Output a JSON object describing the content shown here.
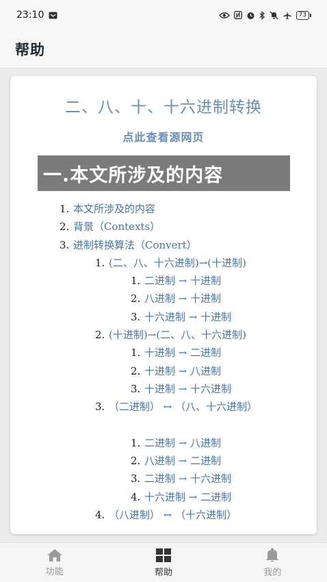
{
  "status_bar": {
    "time": "23:10",
    "battery": "73"
  },
  "app_bar": {
    "title": "帮助"
  },
  "document": {
    "title": "二、八、十、十六进制转换",
    "source_link": "点此查看源网页",
    "section_heading": "一.本文所涉及的内容",
    "toc": [
      {
        "level": 1,
        "num": "1.",
        "label": "本文所涉及的内容"
      },
      {
        "level": 1,
        "num": "2.",
        "label": "背景（Contexts）"
      },
      {
        "level": 1,
        "num": "3.",
        "label": "进制转换算法（Convert）"
      },
      {
        "level": 2,
        "num": "1.",
        "label": "(二、八、十六进制)→(十进制)"
      },
      {
        "level": 3,
        "num": "1.",
        "label": "二进制 → 十进制"
      },
      {
        "level": 3,
        "num": "2.",
        "label": "八进制 → 十进制"
      },
      {
        "level": 3,
        "num": "3.",
        "label": "十六进制 → 十进制"
      },
      {
        "level": 2,
        "num": "2.",
        "label": "(十进制)→(二、八、十六进制)"
      },
      {
        "level": 3,
        "num": "1.",
        "label": "十进制 → 二进制"
      },
      {
        "level": 3,
        "num": "2.",
        "label": "十进制 → 八进制"
      },
      {
        "level": 3,
        "num": "3.",
        "label": "十进制 → 十六进制"
      },
      {
        "level": 2,
        "num": "3.",
        "label": "（二进制） ↔ （八、十六进制）",
        "wrap": true
      },
      {
        "level": 3,
        "num": "1.",
        "label": "二进制 → 八进制"
      },
      {
        "level": 3,
        "num": "2.",
        "label": "八进制 → 二进制"
      },
      {
        "level": 3,
        "num": "3.",
        "label": "二进制 → 十六进制"
      },
      {
        "level": 3,
        "num": "4.",
        "label": "十六进制 → 二进制"
      },
      {
        "level": 2,
        "num": "4.",
        "label": "（八进制） ↔ （十六进制）"
      }
    ]
  },
  "bottom_nav": [
    {
      "label": "功能",
      "icon": "home-icon",
      "active": false
    },
    {
      "label": "帮助",
      "icon": "grid-icon",
      "active": true
    },
    {
      "label": "我的",
      "icon": "bell-icon",
      "active": false
    }
  ]
}
